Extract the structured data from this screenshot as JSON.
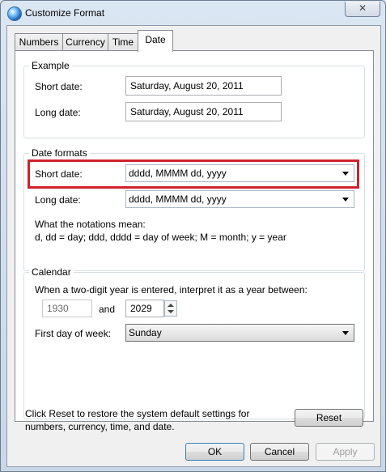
{
  "window": {
    "title": "Customize Format",
    "close_glyph": "✕"
  },
  "tabs": [
    {
      "label": "Numbers"
    },
    {
      "label": "Currency"
    },
    {
      "label": "Time"
    },
    {
      "label": "Date"
    }
  ],
  "example": {
    "legend": "Example",
    "short_label": "Short date:",
    "short_value": "Saturday, August 20, 2011",
    "long_label": "Long date:",
    "long_value": "Saturday, August 20, 2011"
  },
  "date_formats": {
    "legend": "Date formats",
    "short_label": "Short date:",
    "short_value": "dddd, MMMM dd, yyyy",
    "long_label": "Long date:",
    "long_value": "dddd, MMMM dd, yyyy",
    "notation_title": "What the notations mean:",
    "notation_text": "d, dd = day;  ddd, dddd = day of week;  M = month;  y = year",
    "highlight_color": "#d0222e"
  },
  "calendar": {
    "legend": "Calendar",
    "two_digit_text": "When a two-digit year is entered, interpret it as a year between:",
    "year_from": "1930",
    "and_label": "and",
    "year_to": "2029",
    "first_day_label": "First day of week:",
    "first_day_value": "Sunday"
  },
  "reset": {
    "text_line1": "Click Reset to restore the system default settings for",
    "text_line2": "numbers, currency, time, and date.",
    "button": "Reset"
  },
  "footer": {
    "ok": "OK",
    "cancel": "Cancel",
    "apply": "Apply"
  }
}
